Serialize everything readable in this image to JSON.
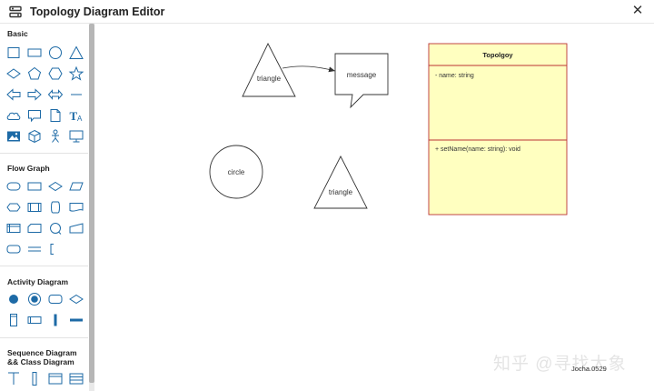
{
  "window": {
    "title": "Topology Diagram Editor",
    "app_icon": "settings-list-icon",
    "close_icon": "close-icon"
  },
  "palette": {
    "sections": [
      {
        "id": "basic",
        "title": "Basic",
        "shapes": [
          "rectangle",
          "rounded-rectangle",
          "circle",
          "triangle",
          "diamond",
          "pentagon",
          "hexagon",
          "star",
          "arrow-left",
          "arrow-right",
          "arrow-both",
          "line",
          "cloud",
          "callout",
          "document",
          "text",
          "image",
          "cube",
          "actor",
          "monitor"
        ]
      },
      {
        "id": "flow",
        "title": "Flow Graph",
        "shapes": [
          "terminator",
          "process",
          "decision",
          "data",
          "preparation",
          "predefined-process",
          "stored-data",
          "document-shape",
          "internal-storage",
          "card",
          "connector",
          "manual-input",
          "delay",
          "equal",
          "annotation"
        ]
      },
      {
        "id": "activity",
        "title": "Activity Diagram",
        "shapes": [
          "initial-state",
          "final-state",
          "action",
          "activity-decision",
          "swimlane-vertical",
          "swimlane-horizontal",
          "fork-vertical",
          "fork-horizontal"
        ]
      },
      {
        "id": "sequence",
        "title": "Sequence Diagram && Class Diagram",
        "shapes": [
          "lifeline",
          "activation",
          "class",
          "class-members"
        ]
      }
    ],
    "accent_color": "#1d6aa6"
  },
  "canvas": {
    "nodes": [
      {
        "id": "t1",
        "type": "triangle",
        "label": "triangle"
      },
      {
        "id": "m1",
        "type": "callout",
        "label": "message"
      },
      {
        "id": "c1",
        "type": "circle",
        "label": "circle"
      },
      {
        "id": "t2",
        "type": "triangle",
        "label": "triangle"
      }
    ],
    "class_box": {
      "title": "Topolgoy",
      "attribute": "- name: string",
      "method": "+ setName(name: string): void",
      "fill": "#ffffc0",
      "border": "#b33"
    }
  },
  "watermark": {
    "text": "知乎 @寻找大象",
    "small_text": "Jocha.0529"
  }
}
